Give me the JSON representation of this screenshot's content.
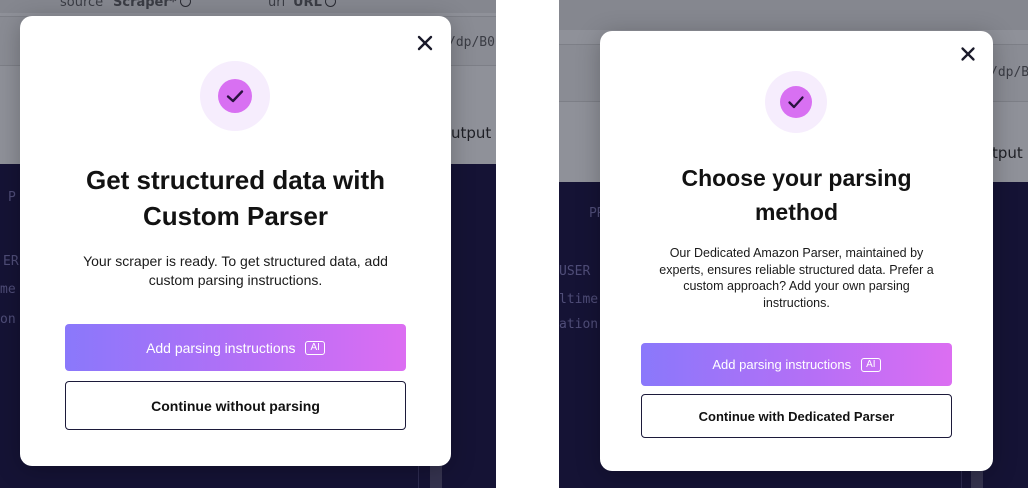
{
  "left": {
    "background": {
      "source_label": "source",
      "source_value": "Scraper*",
      "url_label": "url",
      "url_value": "URL",
      "url_fragment": "/dp/B0",
      "output_fragment": "utput",
      "tab_fragment": "P",
      "code_lines": [
        "ER",
        "me",
        "on"
      ]
    },
    "modal": {
      "close_icon": "close-icon",
      "status_icon": "check-circle-icon",
      "title_line1": "Get structured data with",
      "title_line2": "Custom Parser",
      "body_line1": "Your scraper is ready. To get structured data, add",
      "body_line2": "custom parsing instructions.",
      "primary_label": "Add parsing instructions",
      "primary_badge": "AI",
      "secondary_label": "Continue without parsing"
    }
  },
  "right": {
    "background": {
      "url_fragment": "/dp/B",
      "output_fragment": "tput",
      "tab_fragment": "PR",
      "code_lines": [
        "USER",
        "ltime",
        "ation"
      ]
    },
    "modal": {
      "close_icon": "close-icon",
      "status_icon": "check-circle-icon",
      "title_line1": "Choose your parsing",
      "title_line2": "method",
      "body_line1": "Our Dedicated Amazon Parser, maintained by",
      "body_line2": "experts, ensures reliable structured data. Prefer a",
      "body_line3": "custom approach? Add your own parsing",
      "body_line4": "instructions.",
      "primary_label": "Add parsing instructions",
      "primary_badge": "AI",
      "secondary_label": "Continue with Dedicated Parser"
    }
  },
  "colors": {
    "gradient_start": "#8a78fb",
    "gradient_end": "#dc6ef2",
    "check_fill": "#d870f2",
    "check_halo": "#f6edfd",
    "dark_bg": "#151335",
    "button_border": "#1c1a3a"
  }
}
